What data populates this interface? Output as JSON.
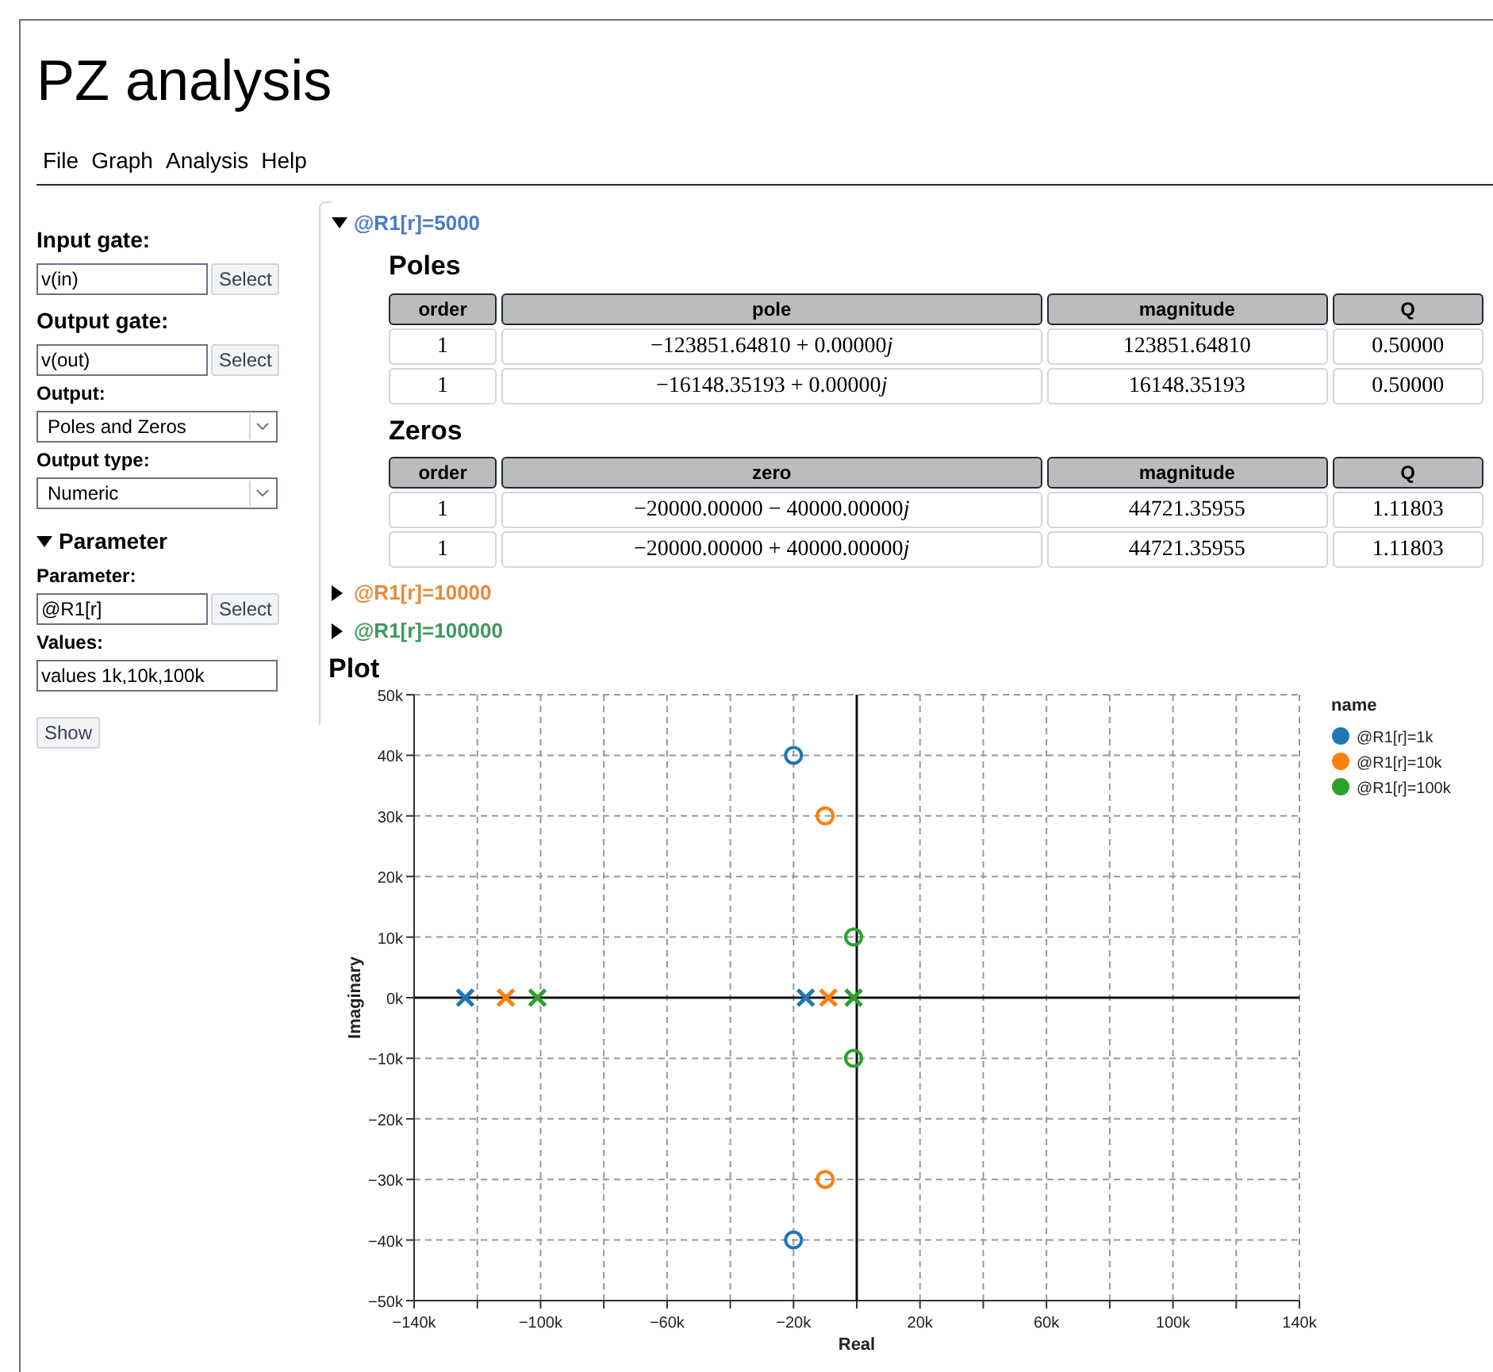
{
  "title": "PZ analysis",
  "menu": [
    "File",
    "Graph",
    "Analysis",
    "Help"
  ],
  "sidebar": {
    "input_gate": {
      "label": "Input gate:",
      "value": "v(in)",
      "button": "Select"
    },
    "output_gate": {
      "label": "Output gate:",
      "value": "v(out)",
      "button": "Select"
    },
    "output": {
      "label": "Output:",
      "value": "Poles and Zeros"
    },
    "output_type": {
      "label": "Output type:",
      "value": "Numeric"
    },
    "parameter_section": {
      "title": "Parameter",
      "expanded": true,
      "parameter": {
        "label": "Parameter:",
        "value": "@R1[r]",
        "button": "Select"
      },
      "values": {
        "label": "Values:",
        "value": "values 1k,10k,100k"
      }
    },
    "show_button": "Show"
  },
  "results": [
    {
      "label": "@R1[r]=5000",
      "color": "#4a7cc9",
      "expanded": true,
      "tables": [
        {
          "title": "Poles",
          "columns": [
            "order",
            "pole",
            "magnitude",
            "Q"
          ],
          "rows": [
            [
              "1",
              {
                "value": "−123851.64810 + 0.00000",
                "unit": "j"
              },
              "123851.64810",
              "0.50000"
            ],
            [
              "1",
              {
                "value": "−16148.35193 + 0.00000",
                "unit": "j"
              },
              "16148.35193",
              "0.50000"
            ]
          ]
        },
        {
          "title": "Zeros",
          "columns": [
            "order",
            "zero",
            "magnitude",
            "Q"
          ],
          "rows": [
            [
              "1",
              {
                "value": "−20000.00000 − 40000.00000",
                "unit": "j"
              },
              "44721.35955",
              "1.11803"
            ],
            [
              "1",
              {
                "value": "−20000.00000 + 40000.00000",
                "unit": "j"
              },
              "44721.35955",
              "1.11803"
            ]
          ]
        }
      ]
    },
    {
      "label": "@R1[r]=10000",
      "color": "#e8893c",
      "expanded": false
    },
    {
      "label": "@R1[r]=100000",
      "color": "#3d9a5c",
      "expanded": false
    }
  ],
  "plot": {
    "title": "Plot",
    "legend_title": "name",
    "chart_data": {
      "type": "scatter",
      "xlabel": "Real",
      "ylabel": "Imaginary",
      "xlim": [
        -140000,
        140000
      ],
      "ylim": [
        -50000,
        50000
      ],
      "xticks": [
        {
          "value": -140000,
          "label": "−140k"
        },
        {
          "value": -100000,
          "label": "−100k"
        },
        {
          "value": -60000,
          "label": "−60k"
        },
        {
          "value": -20000,
          "label": "−20k"
        },
        {
          "value": 20000,
          "label": "20k"
        },
        {
          "value": 60000,
          "label": "60k"
        },
        {
          "value": 100000,
          "label": "100k"
        },
        {
          "value": 140000,
          "label": "140k"
        }
      ],
      "yticks": [
        {
          "value": 50000,
          "label": "50k"
        },
        {
          "value": 40000,
          "label": "40k"
        },
        {
          "value": 30000,
          "label": "30k"
        },
        {
          "value": 20000,
          "label": "20k"
        },
        {
          "value": 10000,
          "label": "10k"
        },
        {
          "value": 0,
          "label": "0k"
        },
        {
          "value": -10000,
          "label": "−10k"
        },
        {
          "value": -20000,
          "label": "−20k"
        },
        {
          "value": -30000,
          "label": "−30k"
        },
        {
          "value": -40000,
          "label": "−40k"
        },
        {
          "value": -50000,
          "label": "−50k"
        }
      ],
      "series": [
        {
          "name": "@R1[r]=1k",
          "color": "#1f77b4",
          "marker": "x",
          "x": [
            -123852,
            -16148
          ],
          "values": [
            0,
            0
          ]
        },
        {
          "color": "#1f77b4",
          "marker": "circle",
          "x": [
            -20000,
            -20000
          ],
          "values": [
            40000,
            -40000
          ]
        },
        {
          "name": "@R1[r]=10k",
          "color": "#ff7f0e",
          "marker": "x",
          "x": [
            -111000,
            -9000
          ],
          "values": [
            0,
            0
          ]
        },
        {
          "color": "#ff7f0e",
          "marker": "circle",
          "x": [
            -10000,
            -10000
          ],
          "values": [
            30000,
            -30000
          ]
        },
        {
          "name": "@R1[r]=100k",
          "color": "#2ca02c",
          "marker": "x",
          "x": [
            -101000,
            -1000
          ],
          "values": [
            0,
            0
          ]
        },
        {
          "color": "#2ca02c",
          "marker": "circle",
          "x": [
            -1000,
            -1000
          ],
          "values": [
            10000,
            -10000
          ]
        }
      ],
      "grid": true,
      "legend": true
    }
  }
}
